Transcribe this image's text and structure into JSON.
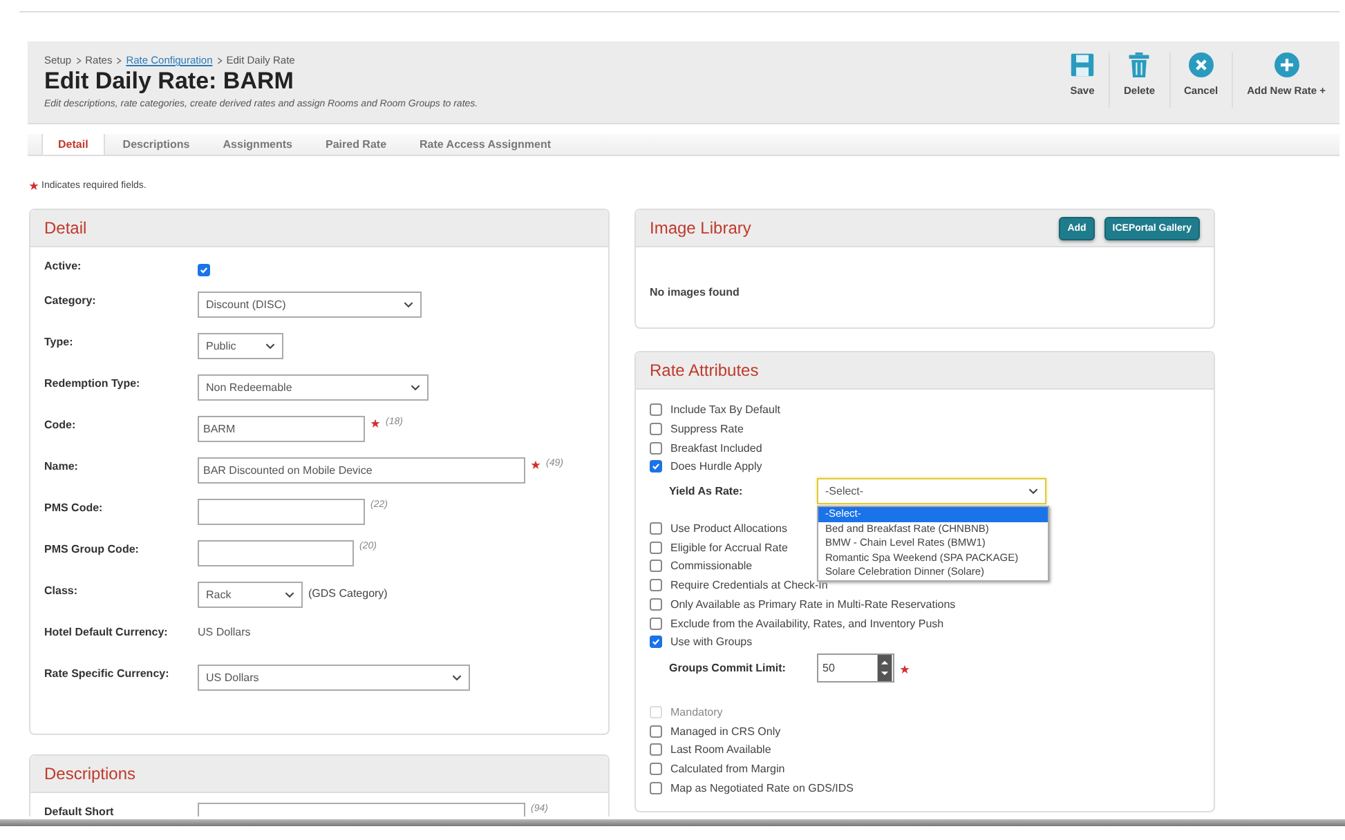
{
  "header": {
    "breadcrumb": [
      {
        "label": "Setup",
        "link": false
      },
      {
        "label": "Rates",
        "link": false
      },
      {
        "label": "Rate Configuration",
        "link": true
      },
      {
        "label": "Edit Daily Rate",
        "link": false
      }
    ],
    "title": "Edit Daily Rate: BARM",
    "subtitle": "Edit descriptions, rate categories, create derived rates and assign Rooms and Room Groups to rates.",
    "actions": [
      {
        "label": "Save"
      },
      {
        "label": "Delete"
      },
      {
        "label": "Cancel"
      },
      {
        "label": "Add New Rate +"
      }
    ]
  },
  "tabs": [
    {
      "label": "Detail",
      "selected": true
    },
    {
      "label": "Descriptions",
      "selected": false
    },
    {
      "label": "Assignments",
      "selected": false
    },
    {
      "label": "Paired Rate",
      "selected": false
    },
    {
      "label": "Rate Access Assignment",
      "selected": false
    }
  ],
  "required_note": "Indicates required fields.",
  "detail": {
    "title": "Detail",
    "fields": [
      {
        "kind": "checkbox",
        "label": "Active:",
        "checked": true
      },
      {
        "kind": "select",
        "label": "Category:",
        "value": "Discount (DISC)"
      },
      {
        "kind": "select",
        "label": "Type:",
        "value": "Public"
      },
      {
        "kind": "select",
        "label": "Redemption Type:",
        "value": "Non Redeemable"
      },
      {
        "kind": "text",
        "label": "Code:",
        "value": "BARM",
        "required": true,
        "hint": "(18)"
      },
      {
        "kind": "text",
        "label": "Name:",
        "value": "BAR Discounted on Mobile Device",
        "required": true,
        "hint": "(49)"
      },
      {
        "kind": "text",
        "label": "PMS Code:",
        "hint": "(22)"
      },
      {
        "kind": "text",
        "label": "PMS Group Code:",
        "hint": "(20)"
      },
      {
        "kind": "select",
        "label": "Class:",
        "value": "Rack",
        "note": "(GDS Category)"
      },
      {
        "kind": "static",
        "label": "Hotel Default Currency:",
        "value": "US Dollars"
      },
      {
        "kind": "select",
        "label": "Rate Specific Currency:",
        "value": "US Dollars"
      }
    ]
  },
  "descriptions": {
    "title": "Descriptions",
    "fields": [
      {
        "kind": "text",
        "label": "Default Short",
        "hint": "(94)"
      }
    ]
  },
  "image_library": {
    "title": "Image Library",
    "buttons": [
      "Add",
      "ICEPortal Gallery"
    ],
    "empty_text": "No images found"
  },
  "rate_attributes": {
    "title": "Rate Attributes",
    "items": [
      {
        "kind": "checkbox",
        "label": "Include Tax By Default",
        "checked": false,
        "disabled": false
      },
      {
        "kind": "checkbox",
        "label": "Suppress Rate",
        "checked": false,
        "disabled": false
      },
      {
        "kind": "checkbox",
        "label": "Breakfast Included",
        "checked": false,
        "disabled": false
      },
      {
        "kind": "checkbox",
        "label": "Does Hurdle Apply",
        "checked": true,
        "disabled": false
      },
      {
        "kind": "select",
        "label": "Yield As Rate:",
        "value": "-Select-",
        "expanded": true,
        "options": [
          {
            "label": "-Select-",
            "selected": true
          },
          {
            "label": "Bed and Breakfast Rate (CHNBNB)",
            "selected": false
          },
          {
            "label": "BMW - Chain Level Rates (BMW1)",
            "selected": false
          },
          {
            "label": "Romantic Spa Weekend (SPA PACKAGE)",
            "selected": false
          },
          {
            "label": "Solare Celebration Dinner (Solare)",
            "selected": false
          }
        ]
      },
      {
        "kind": "checkbox",
        "label": "Use Product Allocations",
        "checked": false,
        "disabled": false
      },
      {
        "kind": "checkbox",
        "label": "Eligible for Accrual Rate",
        "checked": false,
        "disabled": false
      },
      {
        "kind": "checkbox",
        "label": "Commissionable",
        "checked": false,
        "disabled": false
      },
      {
        "kind": "checkbox",
        "label": "Require Credentials at Check-In",
        "checked": false,
        "disabled": false
      },
      {
        "kind": "checkbox",
        "label": "Only Available as Primary Rate in Multi-Rate Reservations",
        "checked": false,
        "disabled": false
      },
      {
        "kind": "checkbox",
        "label": "Exclude from the Availability, Rates, and Inventory Push",
        "checked": false,
        "disabled": false
      },
      {
        "kind": "checkbox",
        "label": "Use with Groups",
        "checked": true,
        "disabled": false
      },
      {
        "kind": "number",
        "label": "Groups Commit Limit:",
        "value": "50",
        "required": true
      },
      {
        "kind": "checkbox",
        "label": "Mandatory",
        "checked": false,
        "disabled": true
      },
      {
        "kind": "checkbox",
        "label": "Managed in CRS Only",
        "checked": false,
        "disabled": false
      },
      {
        "kind": "checkbox",
        "label": "Last Room Available",
        "checked": false,
        "disabled": false
      },
      {
        "kind": "checkbox",
        "label": "Calculated from Margin",
        "checked": false,
        "disabled": false
      },
      {
        "kind": "checkbox",
        "label": "Map as Negotiated Rate on GDS/IDS",
        "checked": false,
        "disabled": false
      }
    ]
  }
}
